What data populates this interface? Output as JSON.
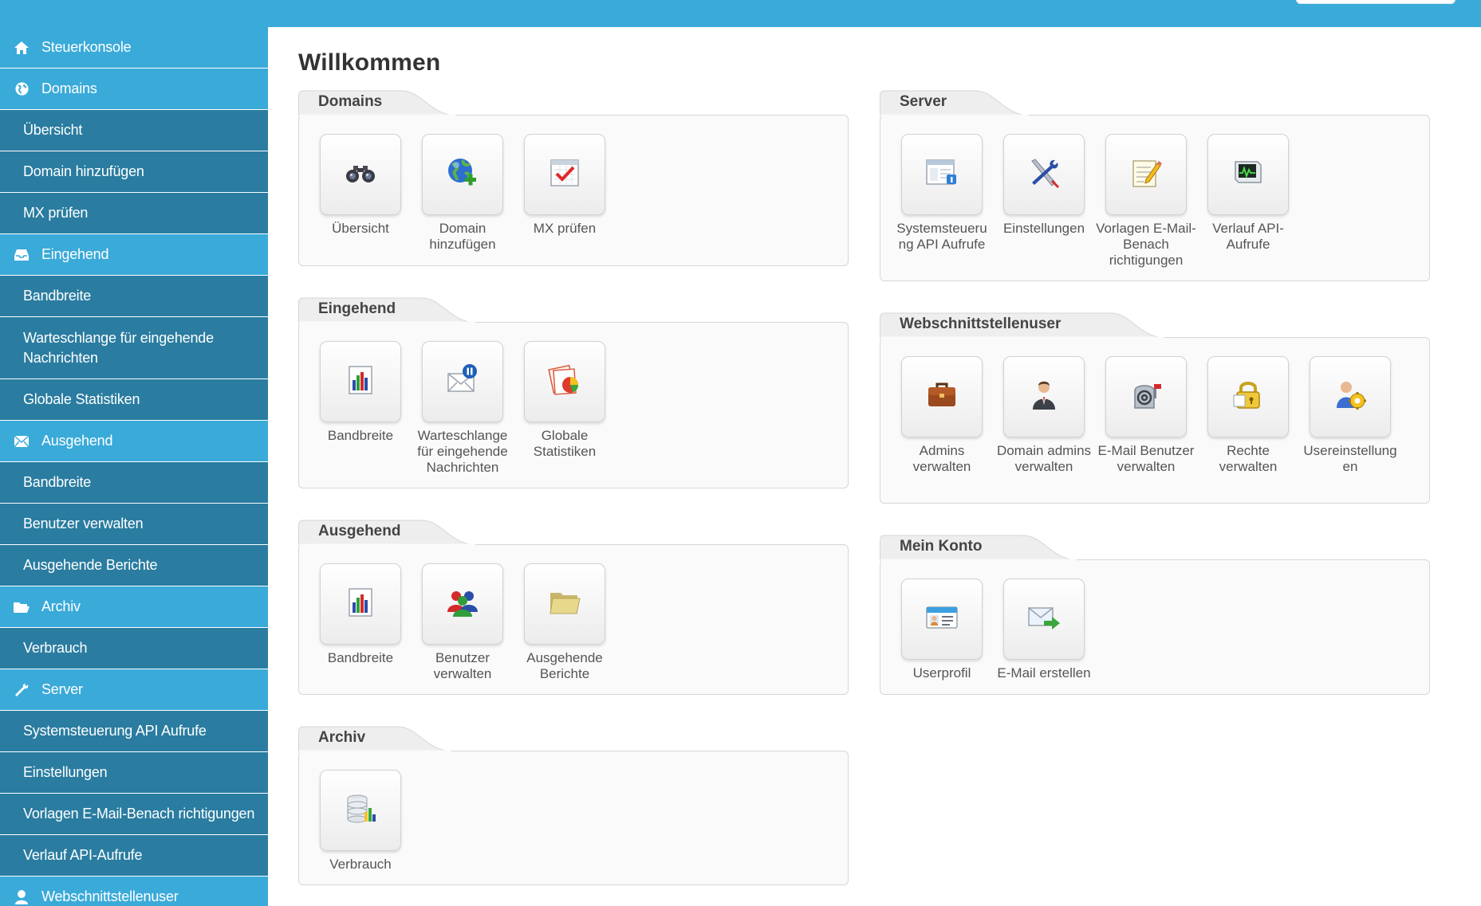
{
  "sidebar": {
    "items": [
      {
        "label": "Steuerkonsole",
        "type": "head",
        "icon": "home-icon"
      },
      {
        "label": "Domains",
        "type": "head",
        "icon": "globe-icon"
      },
      {
        "label": "Übersicht",
        "type": "sub"
      },
      {
        "label": "Domain hinzufügen",
        "type": "sub"
      },
      {
        "label": "MX prüfen",
        "type": "sub"
      },
      {
        "label": "Eingehend",
        "type": "head",
        "icon": "inbox-icon"
      },
      {
        "label": "Bandbreite",
        "type": "sub"
      },
      {
        "label": "Warteschlange für eingehende Nachrichten",
        "type": "sub"
      },
      {
        "label": "Globale Statistiken",
        "type": "sub"
      },
      {
        "label": "Ausgehend",
        "type": "head",
        "icon": "envelope-icon"
      },
      {
        "label": "Bandbreite",
        "type": "sub"
      },
      {
        "label": "Benutzer verwalten",
        "type": "sub"
      },
      {
        "label": "Ausgehende Berichte",
        "type": "sub"
      },
      {
        "label": "Archiv",
        "type": "head",
        "icon": "folder-open-icon"
      },
      {
        "label": "Verbrauch",
        "type": "sub"
      },
      {
        "label": "Server",
        "type": "head",
        "icon": "wrench-icon"
      },
      {
        "label": "Systemsteuerung API Aufrufe",
        "type": "sub"
      },
      {
        "label": "Einstellungen",
        "type": "sub"
      },
      {
        "label": "Vorlagen E-Mail-Benach richtigungen",
        "type": "sub"
      },
      {
        "label": "Verlauf API-Aufrufe",
        "type": "sub"
      },
      {
        "label": "Webschnittstellenuser",
        "type": "head",
        "icon": "user-icon"
      }
    ]
  },
  "main": {
    "title": "Willkommen",
    "panels": {
      "domains": {
        "title": "Domains",
        "tiles": [
          {
            "label": "Übersicht",
            "icon": "binoculars-icon"
          },
          {
            "label": "Domain hinzufügen",
            "icon": "globe-add-icon"
          },
          {
            "label": "MX prüfen",
            "icon": "checklist-icon"
          }
        ]
      },
      "eingehend": {
        "title": "Eingehend",
        "tiles": [
          {
            "label": "Bandbreite",
            "icon": "bar-chart-icon"
          },
          {
            "label": "Warteschlange für eingehende Nachrichten",
            "icon": "mail-pause-icon"
          },
          {
            "label": "Globale Statistiken",
            "icon": "pie-chart-icon"
          }
        ]
      },
      "ausgehend": {
        "title": "Ausgehend",
        "tiles": [
          {
            "label": "Bandbreite",
            "icon": "bar-chart-icon"
          },
          {
            "label": "Benutzer verwalten",
            "icon": "users-group-icon"
          },
          {
            "label": "Ausgehende Berichte",
            "icon": "folder-icon"
          }
        ]
      },
      "archiv": {
        "title": "Archiv",
        "tiles": [
          {
            "label": "Verbrauch",
            "icon": "database-chart-icon"
          }
        ]
      },
      "server": {
        "title": "Server",
        "tiles": [
          {
            "label": "Systemsteueru ng API Aufrufe",
            "icon": "window-info-icon"
          },
          {
            "label": "Einstellungen",
            "icon": "tools-icon"
          },
          {
            "label": "Vorlagen E-Mail-Benach richtigungen",
            "icon": "note-edit-icon"
          },
          {
            "label": "Verlauf API-Aufrufe",
            "icon": "monitor-graph-icon"
          }
        ]
      },
      "webschnittstellenuser": {
        "title": "Webschnittstellenuser",
        "tiles": [
          {
            "label": "Admins verwalten",
            "icon": "briefcase-icon"
          },
          {
            "label": "Domain admins verwalten",
            "icon": "businessman-icon"
          },
          {
            "label": "E-Mail Benutzer verwalten",
            "icon": "mailbox-at-icon"
          },
          {
            "label": "Rechte verwalten",
            "icon": "padlock-icon"
          },
          {
            "label": "Usereinstellung en",
            "icon": "user-settings-icon"
          }
        ]
      },
      "mein_konto": {
        "title": "Mein Konto",
        "tiles": [
          {
            "label": "Userprofil",
            "icon": "id-card-icon"
          },
          {
            "label": "E-Mail erstellen",
            "icon": "mail-forward-icon"
          }
        ]
      }
    }
  },
  "colors": {
    "accent": "#3aaad9",
    "sidebar_sub": "#2a7ca0",
    "panel_border": "#d6d6d6"
  }
}
